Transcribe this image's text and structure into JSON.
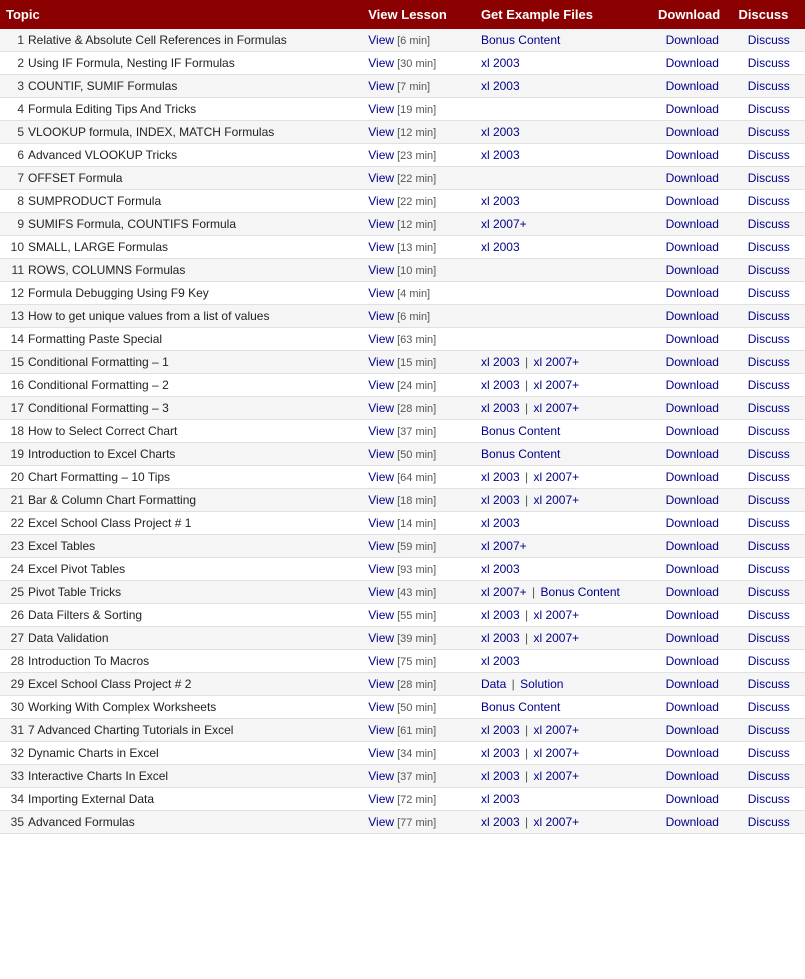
{
  "header": {
    "topic": "Topic",
    "view_lesson": "View Lesson",
    "get_example_files": "Get Example Files",
    "download": "Download",
    "discuss": "Discuss"
  },
  "rows": [
    {
      "num": 1,
      "topic": "Relative & Absolute Cell References in Formulas",
      "view": "View",
      "duration": "[6 min]",
      "files": [
        {
          "label": "Bonus Content",
          "type": "bonus"
        }
      ],
      "has_download": true,
      "has_discuss": true
    },
    {
      "num": 2,
      "topic": "Using IF Formula, Nesting IF Formulas",
      "view": "View",
      "duration": "[30 min]",
      "files": [
        {
          "label": "xl 2003",
          "type": "xl2003"
        }
      ],
      "has_download": true,
      "has_discuss": true
    },
    {
      "num": 3,
      "topic": "COUNTIF, SUMIF Formulas",
      "view": "View",
      "duration": "[7 min]",
      "files": [
        {
          "label": "xl 2003",
          "type": "xl2003"
        }
      ],
      "has_download": true,
      "has_discuss": true
    },
    {
      "num": 4,
      "topic": "Formula Editing Tips And Tricks",
      "view": "View",
      "duration": "[19 min]",
      "files": [],
      "has_download": true,
      "has_discuss": true
    },
    {
      "num": 5,
      "topic": "VLOOKUP formula, INDEX, MATCH Formulas",
      "view": "View",
      "duration": "[12 min]",
      "files": [
        {
          "label": "xl 2003",
          "type": "xl2003"
        }
      ],
      "has_download": true,
      "has_discuss": true
    },
    {
      "num": 6,
      "topic": "Advanced VLOOKUP Tricks",
      "view": "View",
      "duration": "[23 min]",
      "files": [
        {
          "label": "xl 2003",
          "type": "xl2003"
        }
      ],
      "has_download": true,
      "has_discuss": true
    },
    {
      "num": 7,
      "topic": "OFFSET Formula",
      "view": "View",
      "duration": "[22 min]",
      "files": [],
      "has_download": true,
      "has_discuss": true
    },
    {
      "num": 8,
      "topic": "SUMPRODUCT Formula",
      "view": "View",
      "duration": "[22 min]",
      "files": [
        {
          "label": "xl 2003",
          "type": "xl2003"
        }
      ],
      "has_download": true,
      "has_discuss": true
    },
    {
      "num": 9,
      "topic": "SUMIFS Formula, COUNTIFS Formula",
      "view": "View",
      "duration": "[12 min]",
      "files": [
        {
          "label": "xl 2007+",
          "type": "xl2007"
        }
      ],
      "has_download": true,
      "has_discuss": true
    },
    {
      "num": 10,
      "topic": "SMALL, LARGE Formulas",
      "view": "View",
      "duration": "[13 min]",
      "files": [
        {
          "label": "xl 2003",
          "type": "xl2003"
        }
      ],
      "has_download": true,
      "has_discuss": true
    },
    {
      "num": 11,
      "topic": "ROWS, COLUMNS Formulas",
      "view": "View",
      "duration": "[10 min]",
      "files": [],
      "has_download": true,
      "has_discuss": true
    },
    {
      "num": 12,
      "topic": "Formula Debugging Using F9 Key",
      "view": "View",
      "duration": "[4 min]",
      "files": [],
      "has_download": true,
      "has_discuss": true
    },
    {
      "num": 13,
      "topic": "How to get unique values from a list of values",
      "view": "View",
      "duration": "[6 min]",
      "files": [],
      "has_download": true,
      "has_discuss": true
    },
    {
      "num": 14,
      "topic": "Formatting Paste Special",
      "view": "View",
      "duration": "[63 min]",
      "files": [],
      "has_download": true,
      "has_discuss": true
    },
    {
      "num": 15,
      "topic": "Conditional Formatting – 1",
      "view": "View",
      "duration": "[15 min]",
      "files": [
        {
          "label": "xl 2003",
          "type": "xl2003"
        },
        {
          "label": "xl 2007+",
          "type": "xl2007"
        }
      ],
      "has_download": true,
      "has_discuss": true
    },
    {
      "num": 16,
      "topic": "Conditional Formatting – 2",
      "view": "View",
      "duration": "[24 min]",
      "files": [
        {
          "label": "xl 2003",
          "type": "xl2003"
        },
        {
          "label": "xl 2007+",
          "type": "xl2007"
        }
      ],
      "has_download": true,
      "has_discuss": true
    },
    {
      "num": 17,
      "topic": "Conditional Formatting – 3",
      "view": "View",
      "duration": "[28 min]",
      "files": [
        {
          "label": "xl 2003",
          "type": "xl2003"
        },
        {
          "label": "xl 2007+",
          "type": "xl2007"
        }
      ],
      "has_download": true,
      "has_discuss": true
    },
    {
      "num": 18,
      "topic": "How to Select Correct Chart",
      "view": "View",
      "duration": "[37 min]",
      "files": [
        {
          "label": "Bonus Content",
          "type": "bonus"
        }
      ],
      "has_download": true,
      "has_discuss": true
    },
    {
      "num": 19,
      "topic": "Introduction to Excel Charts",
      "view": "View",
      "duration": "[50 min]",
      "files": [
        {
          "label": "Bonus Content",
          "type": "bonus"
        }
      ],
      "has_download": true,
      "has_discuss": true
    },
    {
      "num": 20,
      "topic": "Chart Formatting – 10 Tips",
      "view": "View",
      "duration": "[64 min]",
      "files": [
        {
          "label": "xl 2003",
          "type": "xl2003"
        },
        {
          "label": "xl 2007+",
          "type": "xl2007"
        }
      ],
      "has_download": true,
      "has_discuss": true
    },
    {
      "num": 21,
      "topic": "Bar & Column Chart Formatting",
      "view": "View",
      "duration": "[18 min]",
      "files": [
        {
          "label": "xl 2003",
          "type": "xl2003"
        },
        {
          "label": "xl 2007+",
          "type": "xl2007"
        }
      ],
      "has_download": true,
      "has_discuss": true
    },
    {
      "num": 22,
      "topic": "Excel School Class Project # 1",
      "view": "View",
      "duration": "[14 min]",
      "files": [
        {
          "label": "xl 2003",
          "type": "xl2003"
        }
      ],
      "has_download": true,
      "has_discuss": true
    },
    {
      "num": 23,
      "topic": "Excel Tables",
      "view": "View",
      "duration": "[59 min]",
      "files": [
        {
          "label": "xl 2007+",
          "type": "xl2007"
        }
      ],
      "has_download": true,
      "has_discuss": true
    },
    {
      "num": 24,
      "topic": "Excel Pivot Tables",
      "view": "View",
      "duration": "[93 min]",
      "files": [
        {
          "label": "xl 2003",
          "type": "xl2003"
        }
      ],
      "has_download": true,
      "has_discuss": true
    },
    {
      "num": 25,
      "topic": "Pivot Table Tricks",
      "view": "View",
      "duration": "[43 min]",
      "files": [
        {
          "label": "xl 2007+",
          "type": "xl2007"
        },
        {
          "label": "Bonus Content",
          "type": "bonus"
        }
      ],
      "has_download": true,
      "has_discuss": true
    },
    {
      "num": 26,
      "topic": "Data Filters & Sorting",
      "view": "View",
      "duration": "[55 min]",
      "files": [
        {
          "label": "xl 2003",
          "type": "xl2003"
        },
        {
          "label": "xl 2007+",
          "type": "xl2007"
        }
      ],
      "has_download": true,
      "has_discuss": true
    },
    {
      "num": 27,
      "topic": "Data Validation",
      "view": "View",
      "duration": "[39 min]",
      "files": [
        {
          "label": "xl 2003",
          "type": "xl2003"
        },
        {
          "label": "xl 2007+",
          "type": "xl2007"
        }
      ],
      "has_download": true,
      "has_discuss": true
    },
    {
      "num": 28,
      "topic": "Introduction To Macros",
      "view": "View",
      "duration": "[75 min]",
      "files": [
        {
          "label": "xl 2003",
          "type": "xl2003"
        }
      ],
      "has_download": true,
      "has_discuss": true
    },
    {
      "num": 29,
      "topic": "Excel School Class Project # 2",
      "view": "View",
      "duration": "[28 min]",
      "files": [
        {
          "label": "Data",
          "type": "data"
        },
        {
          "label": "Solution",
          "type": "solution"
        }
      ],
      "has_download": true,
      "has_discuss": true
    },
    {
      "num": 30,
      "topic": "Working With Complex Worksheets",
      "view": "View",
      "duration": "[50 min]",
      "files": [
        {
          "label": "Bonus Content",
          "type": "bonus"
        }
      ],
      "has_download": true,
      "has_discuss": true
    },
    {
      "num": 31,
      "topic": "7 Advanced Charting Tutorials in Excel",
      "view": "View",
      "duration": "[61 min]",
      "files": [
        {
          "label": "xl 2003",
          "type": "xl2003"
        },
        {
          "label": "xl 2007+",
          "type": "xl2007"
        }
      ],
      "has_download": true,
      "has_discuss": true
    },
    {
      "num": 32,
      "topic": "Dynamic Charts in Excel",
      "view": "View",
      "duration": "[34 min]",
      "files": [
        {
          "label": "xl 2003",
          "type": "xl2003"
        },
        {
          "label": "xl 2007+",
          "type": "xl2007"
        }
      ],
      "has_download": true,
      "has_discuss": true
    },
    {
      "num": 33,
      "topic": "Interactive Charts In Excel",
      "view": "View",
      "duration": "[37 min]",
      "files": [
        {
          "label": "xl 2003",
          "type": "xl2003"
        },
        {
          "label": "xl 2007+",
          "type": "xl2007"
        }
      ],
      "has_download": true,
      "has_discuss": true
    },
    {
      "num": 34,
      "topic": "Importing External Data",
      "view": "View",
      "duration": "[72 min]",
      "files": [
        {
          "label": "xl 2003",
          "type": "xl2003"
        }
      ],
      "has_download": true,
      "has_discuss": true
    },
    {
      "num": 35,
      "topic": "Advanced Formulas",
      "view": "View",
      "duration": "[77 min]",
      "files": [
        {
          "label": "xl 2003",
          "type": "xl2003"
        },
        {
          "label": "xl 2007+",
          "type": "xl2007"
        }
      ],
      "has_download": true,
      "has_discuss": true
    }
  ],
  "labels": {
    "download": "Download",
    "discuss": "Discuss"
  }
}
